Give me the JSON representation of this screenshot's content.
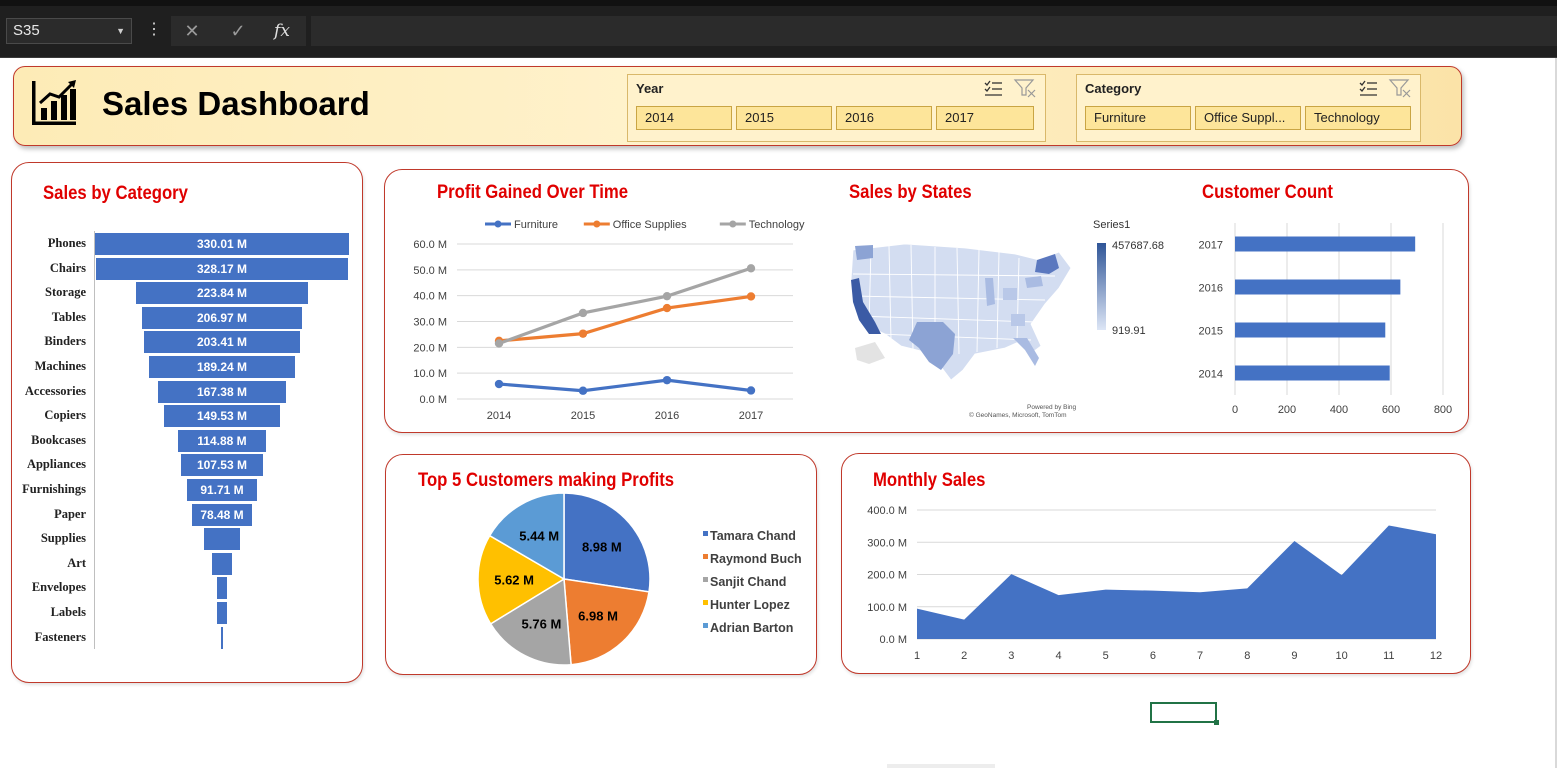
{
  "app": {
    "name_box": "S35",
    "formula_buttons": {
      "cancel": "✕",
      "enter": "✓",
      "function": "fx"
    }
  },
  "header": {
    "title": "Sales Dashboard",
    "slicers": [
      {
        "title": "Year",
        "items": [
          "2014",
          "2015",
          "2016",
          "2017"
        ]
      },
      {
        "title": "Category",
        "items": [
          "Furniture",
          "Office Suppl...",
          "Technology"
        ]
      }
    ]
  },
  "panels": {
    "sales_by_category": "Sales by Category",
    "profit_over_time": "Profit Gained Over Time",
    "sales_by_states": "Sales by States",
    "customer_count": "Customer Count",
    "top_customers": "Top 5 Customers making Profits",
    "monthly_sales": "Monthly Sales"
  },
  "colors": {
    "accent_red": "#e00000",
    "border_red": "#c0392b",
    "bar_blue": "#4472c4",
    "orange": "#ed7d31",
    "gray": "#a5a5a5",
    "yellow": "#ffc000",
    "light_blue": "#5b9bd5"
  },
  "chart_data": [
    {
      "type": "bar",
      "id": "sales_by_category",
      "title": "Sales by Category",
      "categories": [
        "Phones",
        "Chairs",
        "Storage",
        "Tables",
        "Binders",
        "Machines",
        "Accessories",
        "Copiers",
        "Bookcases",
        "Appliances",
        "Furnishings",
        "Paper",
        "Supplies",
        "Art",
        "Envelopes",
        "Labels",
        "Fasteners"
      ],
      "values": [
        330.01,
        328.17,
        223.84,
        206.97,
        203.41,
        189.24,
        167.38,
        149.53,
        114.88,
        107.53,
        91.71,
        78.48,
        46,
        27,
        14,
        12,
        2
      ],
      "labels": [
        "330.01 M",
        "328.17 M",
        "223.84 M",
        "206.97 M",
        "203.41 M",
        "189.24 M",
        "167.38 M",
        "149.53 M",
        "114.88 M",
        "107.53 M",
        "91.71 M",
        "78.48 M",
        "",
        "",
        "",
        "",
        ""
      ]
    },
    {
      "type": "line",
      "id": "profit_over_time",
      "title": "Profit Gained Over Time",
      "x": [
        "2014",
        "2015",
        "2016",
        "2017"
      ],
      "ylim": [
        0,
        60
      ],
      "yticks": [
        "0.0 M",
        "10.0 M",
        "20.0 M",
        "30.0 M",
        "40.0 M",
        "50.0 M",
        "60.0 M"
      ],
      "legend": "top",
      "series": [
        {
          "name": "Furniture",
          "color": "#4472c4",
          "values": [
            5.8,
            3.2,
            7.3,
            3.3
          ]
        },
        {
          "name": "Office Supplies",
          "color": "#ed7d31",
          "values": [
            22.5,
            25.3,
            35.2,
            39.7
          ]
        },
        {
          "name": "Technology",
          "color": "#a5a5a5",
          "values": [
            21.5,
            33.3,
            39.8,
            50.6
          ]
        }
      ]
    },
    {
      "type": "heatmap",
      "id": "sales_by_states",
      "title": "Sales by States",
      "legend_title": "Series1",
      "max": "457687.68",
      "min": "919.91",
      "credit_line1": "Powered by Bing",
      "credit_line2": "© GeoNames, Microsoft, TomTom"
    },
    {
      "type": "bar",
      "id": "customer_count",
      "title": "Customer Count",
      "orientation": "horizontal",
      "categories": [
        "2017",
        "2016",
        "2015",
        "2014"
      ],
      "values": [
        693,
        636,
        578,
        595
      ],
      "xlim": [
        0,
        800
      ],
      "xticks": [
        "0",
        "200",
        "400",
        "600",
        "800"
      ]
    },
    {
      "type": "pie",
      "id": "top_customers",
      "title": "Top 5 Customers making Profits",
      "legend": "right",
      "slices": [
        {
          "name": "Tamara Chand",
          "value": 8.98,
          "label": "8.98 M",
          "color": "#4472c4"
        },
        {
          "name": "Raymond Buch",
          "value": 6.98,
          "label": "6.98 M",
          "color": "#ed7d31"
        },
        {
          "name": "Sanjit Chand",
          "value": 5.76,
          "label": "5.76 M",
          "color": "#a5a5a5"
        },
        {
          "name": "Hunter Lopez",
          "value": 5.62,
          "label": "5.62 M",
          "color": "#ffc000"
        },
        {
          "name": "Adrian Barton",
          "value": 5.44,
          "label": "5.44 M",
          "color": "#5b9bd5"
        }
      ]
    },
    {
      "type": "area",
      "id": "monthly_sales",
      "title": "Monthly Sales",
      "x": [
        "1",
        "2",
        "3",
        "4",
        "5",
        "6",
        "7",
        "8",
        "9",
        "10",
        "11",
        "12"
      ],
      "values": [
        94,
        60,
        201,
        136,
        153,
        150,
        145,
        157,
        304,
        198,
        352,
        325
      ],
      "ylim": [
        0,
        400
      ],
      "yticks": [
        "0.0 M",
        "100.0 M",
        "200.0 M",
        "300.0 M",
        "400.0 M"
      ],
      "color": "#4472c4"
    }
  ]
}
